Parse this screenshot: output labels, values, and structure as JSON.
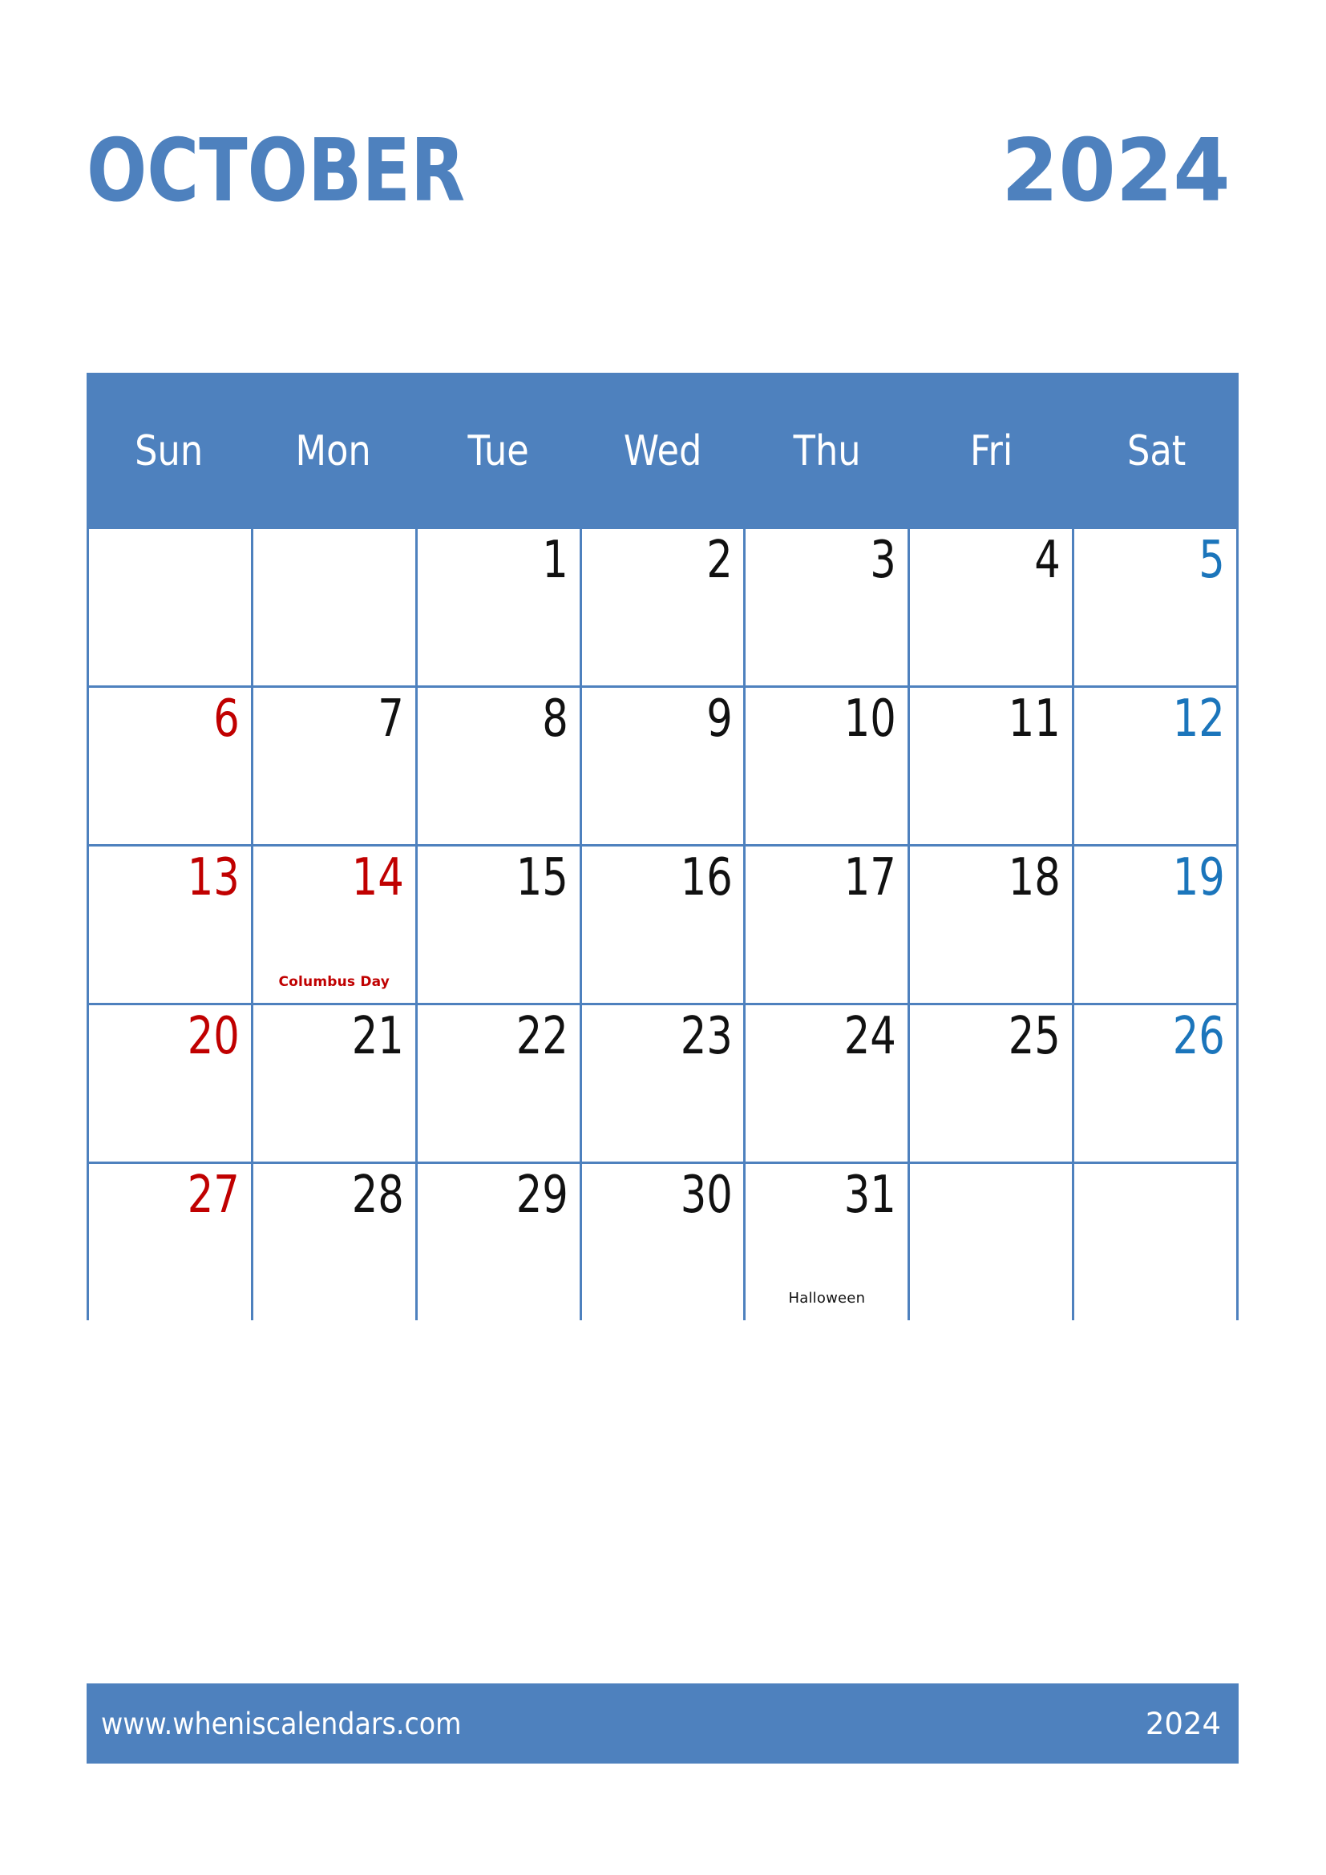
{
  "header": {
    "month": "OCTOBER",
    "year": "2024"
  },
  "colors": {
    "brand_blue": "#4E81BE",
    "saturday_blue": "#1B75BB",
    "sunday_red": "#C00000",
    "weekday_black": "#111111",
    "background": "#FFFFFF"
  },
  "weekdays": [
    {
      "label": "Sun"
    },
    {
      "label": "Mon"
    },
    {
      "label": "Tue"
    },
    {
      "label": "Wed"
    },
    {
      "label": "Thu"
    },
    {
      "label": "Fri"
    },
    {
      "label": "Sat"
    }
  ],
  "weeks": [
    [
      {
        "day": ""
      },
      {
        "day": ""
      },
      {
        "day": "1",
        "kind": "weekday"
      },
      {
        "day": "2",
        "kind": "weekday"
      },
      {
        "day": "3",
        "kind": "weekday"
      },
      {
        "day": "4",
        "kind": "weekday"
      },
      {
        "day": "5",
        "kind": "saturday"
      }
    ],
    [
      {
        "day": "6",
        "kind": "sunday"
      },
      {
        "day": "7",
        "kind": "weekday"
      },
      {
        "day": "8",
        "kind": "weekday"
      },
      {
        "day": "9",
        "kind": "weekday"
      },
      {
        "day": "10",
        "kind": "weekday"
      },
      {
        "day": "11",
        "kind": "weekday"
      },
      {
        "day": "12",
        "kind": "saturday"
      }
    ],
    [
      {
        "day": "13",
        "kind": "sunday"
      },
      {
        "day": "14",
        "kind": "holiday",
        "event": "Columbus Day",
        "event_style": "holiday"
      },
      {
        "day": "15",
        "kind": "weekday"
      },
      {
        "day": "16",
        "kind": "weekday"
      },
      {
        "day": "17",
        "kind": "weekday"
      },
      {
        "day": "18",
        "kind": "weekday"
      },
      {
        "day": "19",
        "kind": "saturday"
      }
    ],
    [
      {
        "day": "20",
        "kind": "sunday"
      },
      {
        "day": "21",
        "kind": "weekday"
      },
      {
        "day": "22",
        "kind": "weekday"
      },
      {
        "day": "23",
        "kind": "weekday"
      },
      {
        "day": "24",
        "kind": "weekday"
      },
      {
        "day": "25",
        "kind": "weekday"
      },
      {
        "day": "26",
        "kind": "saturday"
      }
    ],
    [
      {
        "day": "27",
        "kind": "sunday"
      },
      {
        "day": "28",
        "kind": "weekday"
      },
      {
        "day": "29",
        "kind": "weekday"
      },
      {
        "day": "30",
        "kind": "weekday"
      },
      {
        "day": "31",
        "kind": "weekday",
        "event": "Halloween",
        "event_style": "plain"
      },
      {
        "day": ""
      },
      {
        "day": ""
      }
    ]
  ],
  "footer": {
    "url": "www.wheniscalendars.com",
    "year": "2024"
  }
}
